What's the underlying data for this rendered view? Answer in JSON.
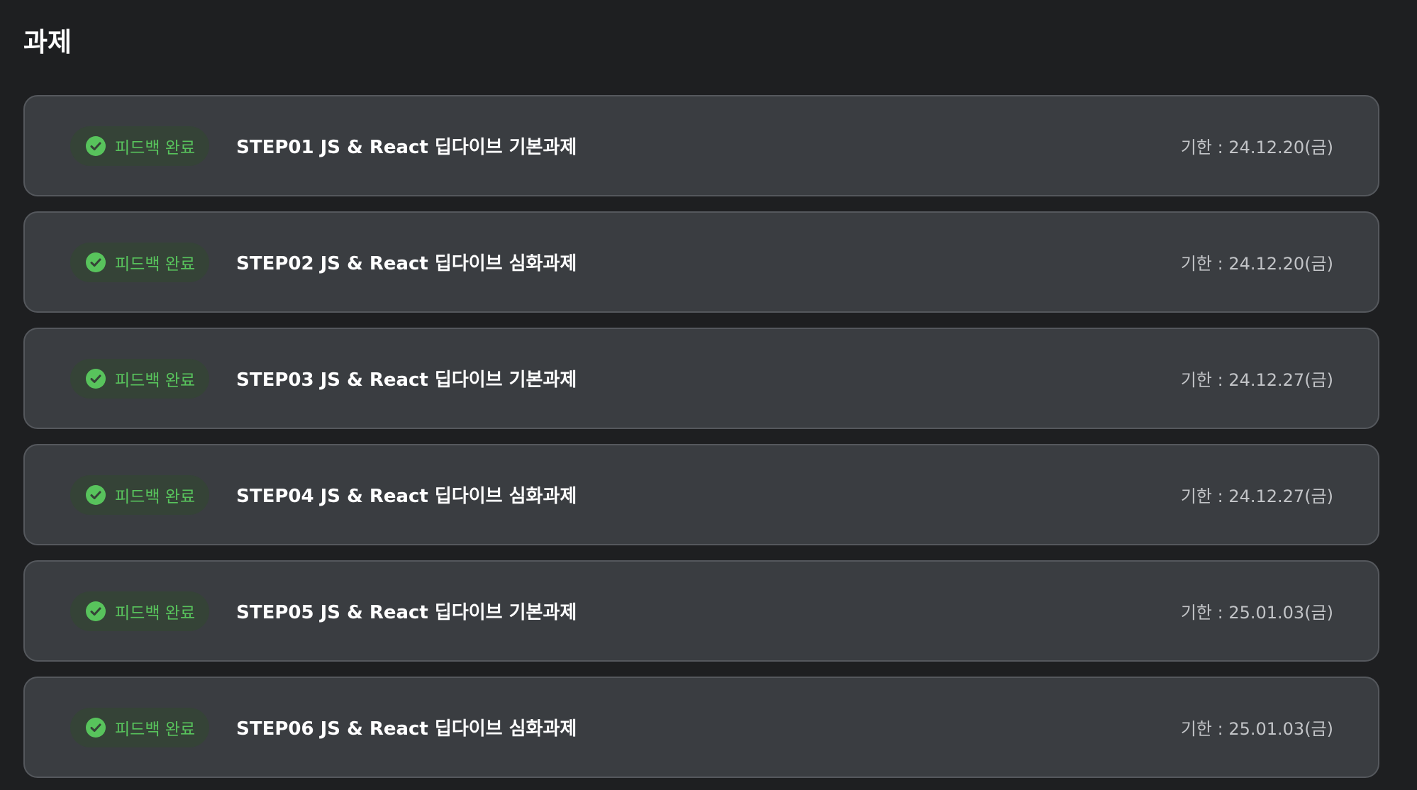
{
  "page": {
    "title": "과제"
  },
  "colors": {
    "background": "#1e1f21",
    "card": "#3a3d41",
    "card_border": "#55585d",
    "badge_bg": "#354337",
    "accent_green": "#58c35c"
  },
  "assignments": [
    {
      "status_icon": "check-circle-icon",
      "status": "피드백 완료",
      "title": "STEP01 JS & React 딥다이브 기본과제",
      "due": "기한 : 24.12.20(금)"
    },
    {
      "status_icon": "check-circle-icon",
      "status": "피드백 완료",
      "title": "STEP02 JS & React 딥다이브 심화과제",
      "due": "기한 : 24.12.20(금)"
    },
    {
      "status_icon": "check-circle-icon",
      "status": "피드백 완료",
      "title": "STEP03 JS & React 딥다이브 기본과제",
      "due": "기한 : 24.12.27(금)"
    },
    {
      "status_icon": "check-circle-icon",
      "status": "피드백 완료",
      "title": "STEP04 JS & React 딥다이브 심화과제",
      "due": "기한 : 24.12.27(금)"
    },
    {
      "status_icon": "check-circle-icon",
      "status": "피드백 완료",
      "title": "STEP05 JS & React 딥다이브 기본과제",
      "due": "기한 : 25.01.03(금)"
    },
    {
      "status_icon": "check-circle-icon",
      "status": "피드백 완료",
      "title": "STEP06 JS & React 딥다이브 심화과제",
      "due": "기한 : 25.01.03(금)"
    }
  ]
}
